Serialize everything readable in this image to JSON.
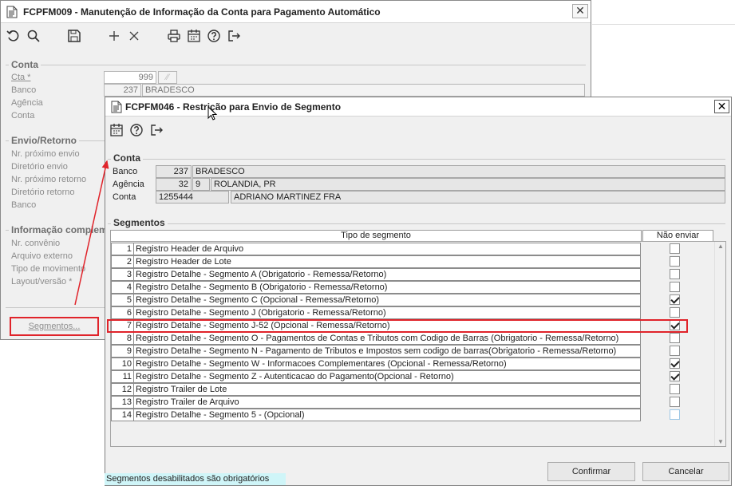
{
  "win1": {
    "title": "FCPFM009 - Manutenção de Informação da Conta para Pagamento Automático",
    "close_label": "✕",
    "conta": {
      "group_label": "Conta",
      "cta_label": "Cta *",
      "cta_value": "999",
      "banco_label": "Banco",
      "banco_code": "237",
      "banco_name": "BRADESCO",
      "agencia_label": "Agência",
      "conta_label": "Conta"
    },
    "envio": {
      "group_label": "Envio/Retorno",
      "fields": [
        "Nr. próximo envio",
        "Diretório envio",
        "Nr. próximo retorno",
        "Diretório retorno",
        "Banco"
      ]
    },
    "info": {
      "group_label": "Informação complem",
      "fields": [
        "Nr. convênio",
        "Arquivo externo",
        "Tipo de movimento",
        "Layout/versão *"
      ]
    },
    "segmentos_button": "Segmentos..."
  },
  "win2": {
    "title": "FCPFM046 - Restrição para Envio de Segmento",
    "close_label": "✕",
    "conta": {
      "group_label": "Conta",
      "banco_label": "Banco",
      "banco_code": "237",
      "banco_name": "BRADESCO",
      "agencia_label": "Agência",
      "agencia_code": "32",
      "agencia_dv": "9",
      "agencia_name": "ROLANDIA, PR",
      "conta_label": "Conta",
      "conta_number": "1255444",
      "conta_name": "ADRIANO MARTINEZ FRA"
    },
    "segmentos": {
      "group_label": "Segmentos",
      "col_tipo": "Tipo de segmento",
      "col_nao_enviar": "Não enviar",
      "rows": [
        {
          "num": "1",
          "desc": "Registro Header de Arquivo",
          "checked": false
        },
        {
          "num": "2",
          "desc": "Registro Header de Lote",
          "checked": false
        },
        {
          "num": "3",
          "desc": "Registro Detalhe - Segmento A (Obrigatorio - Remessa/Retorno)",
          "checked": false
        },
        {
          "num": "4",
          "desc": "Registro Detalhe - Segmento B (Obrigatorio - Remessa/Retorno)",
          "checked": false
        },
        {
          "num": "5",
          "desc": "Registro Detalhe - Segmento C (Opcional - Remessa/Retorno)",
          "checked": true
        },
        {
          "num": "6",
          "desc": "Registro Detalhe - Segmento J (Obrigatorio - Remessa/Retorno)",
          "checked": false
        },
        {
          "num": "7",
          "desc": "Registro Detalhe - Segmento J-52 (Opcional - Remessa/Retorno)",
          "checked": true
        },
        {
          "num": "8",
          "desc": "Registro Detalhe - Segmento O - Pagamentos de Contas e Tributos com Codigo de Barras (Obrigatorio - Remessa/Retorno)",
          "checked": false
        },
        {
          "num": "9",
          "desc": "Registro Detalhe - Segmento N - Pagamento de Tributos e Impostos sem codigo de barras(Obrigatorio - Remessa/Retorno)",
          "checked": false
        },
        {
          "num": "10",
          "desc": "Registro Detalhe - Segmento W - Informacoes Complementares (Opcional - Remessa/Retorno)",
          "checked": true
        },
        {
          "num": "11",
          "desc": "Registro Detalhe - Segmento Z - Autenticacao do Pagamento(Opcional - Retorno)",
          "checked": true
        },
        {
          "num": "12",
          "desc": "Registro Trailer de Lote",
          "checked": false
        },
        {
          "num": "13",
          "desc": "Registro Trailer de Arquivo",
          "checked": false
        },
        {
          "num": "14",
          "desc": "Registro Detalhe - Segmento 5 - (Opcional)",
          "checked": false
        }
      ]
    },
    "confirm_label": "Confirmar",
    "cancel_label": "Cancelar",
    "status_text": "Segmentos desabilitados são obrigatórios"
  },
  "colors": {
    "annotation_red": "#e0232a",
    "status_bg": "#cff5f8"
  },
  "icons": {
    "toolbar1": [
      "undo-icon",
      "search-icon",
      "save-icon",
      "add-icon",
      "delete-icon",
      "print-icon",
      "calendar-icon",
      "help-icon",
      "exit-icon"
    ],
    "toolbar2": [
      "calendar-icon",
      "help-icon",
      "exit-icon"
    ]
  }
}
